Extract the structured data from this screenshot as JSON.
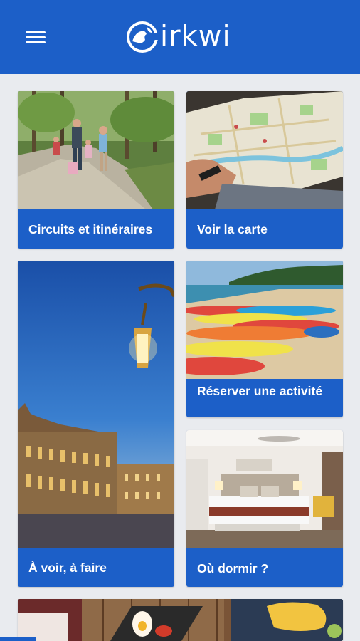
{
  "app": {
    "logo_text": "irkwi",
    "brand_color": "#1c5fc8",
    "menu_icon": "hamburger-menu-icon"
  },
  "tiles": [
    {
      "id": "circuits",
      "label": "Circuits et itinéraires",
      "image": "family-walking-forest-path"
    },
    {
      "id": "map",
      "label": "Voir la carte",
      "image": "person-holding-city-map"
    },
    {
      "id": "sights",
      "label": "À voir, à faire",
      "image": "illuminated-square-at-dusk"
    },
    {
      "id": "activity",
      "label": "Réserver une activité",
      "image": "kayaks-on-beach"
    },
    {
      "id": "sleep",
      "label": "Où dormir ?",
      "image": "hotel-bedroom"
    },
    {
      "id": "food",
      "label": "",
      "image": "food-table-partial"
    }
  ]
}
